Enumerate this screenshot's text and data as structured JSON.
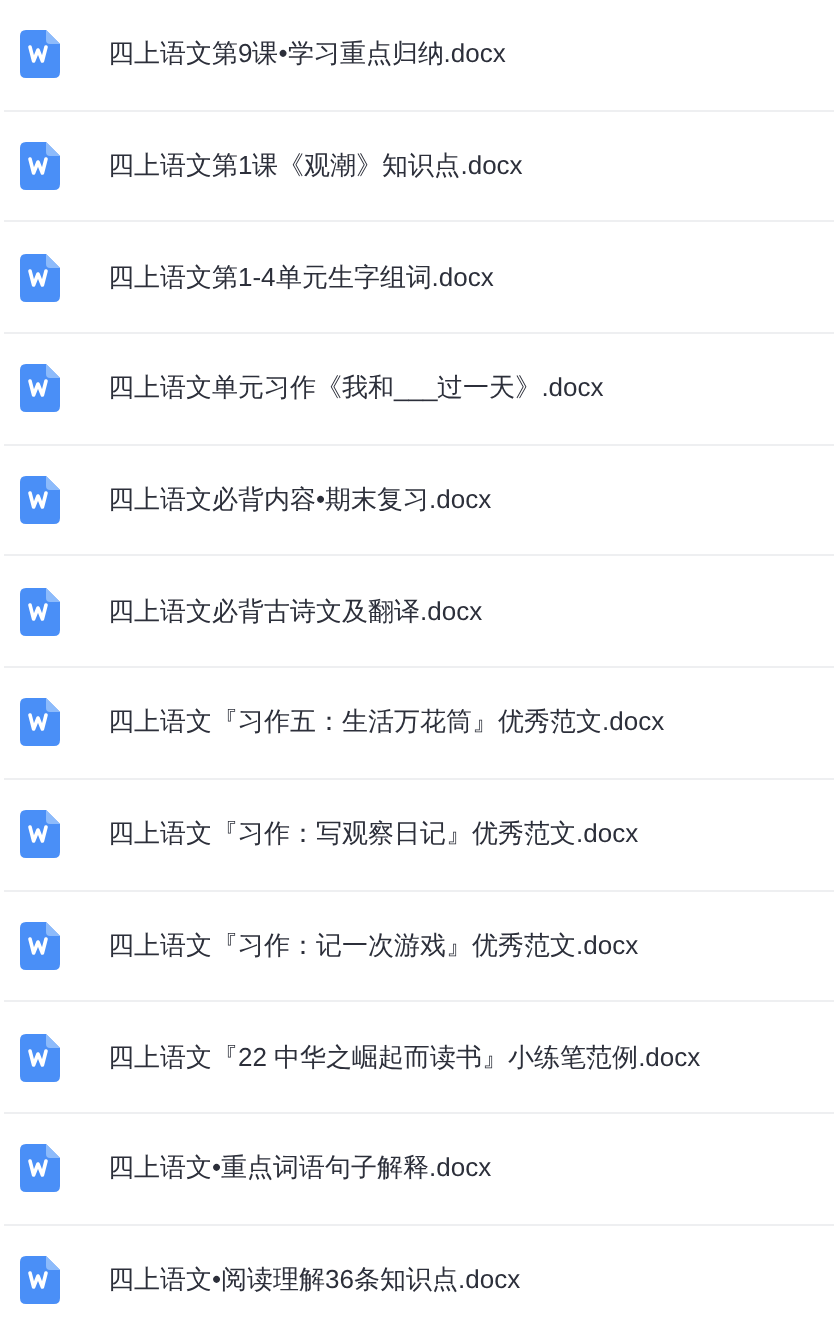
{
  "files": [
    {
      "name": "四上语文第9课•学习重点归纳.docx"
    },
    {
      "name": "四上语文第1课《观潮》知识点.docx"
    },
    {
      "name": "四上语文第1-4单元生字组词.docx"
    },
    {
      "name": "四上语文单元习作《我和___过一天》.docx"
    },
    {
      "name": "四上语文必背内容•期末复习.docx"
    },
    {
      "name": "四上语文必背古诗文及翻译.docx"
    },
    {
      "name": "四上语文『习作五：生活万花筒』优秀范文.docx"
    },
    {
      "name": "四上语文『习作：写观察日记』优秀范文.docx"
    },
    {
      "name": "四上语文『习作：记一次游戏』优秀范文.docx"
    },
    {
      "name": "四上语文『22 中华之崛起而读书』小练笔范例.docx"
    },
    {
      "name": "四上语文•重点词语句子解释.docx"
    },
    {
      "name": "四上语文•阅读理解36条知识点.docx"
    }
  ]
}
